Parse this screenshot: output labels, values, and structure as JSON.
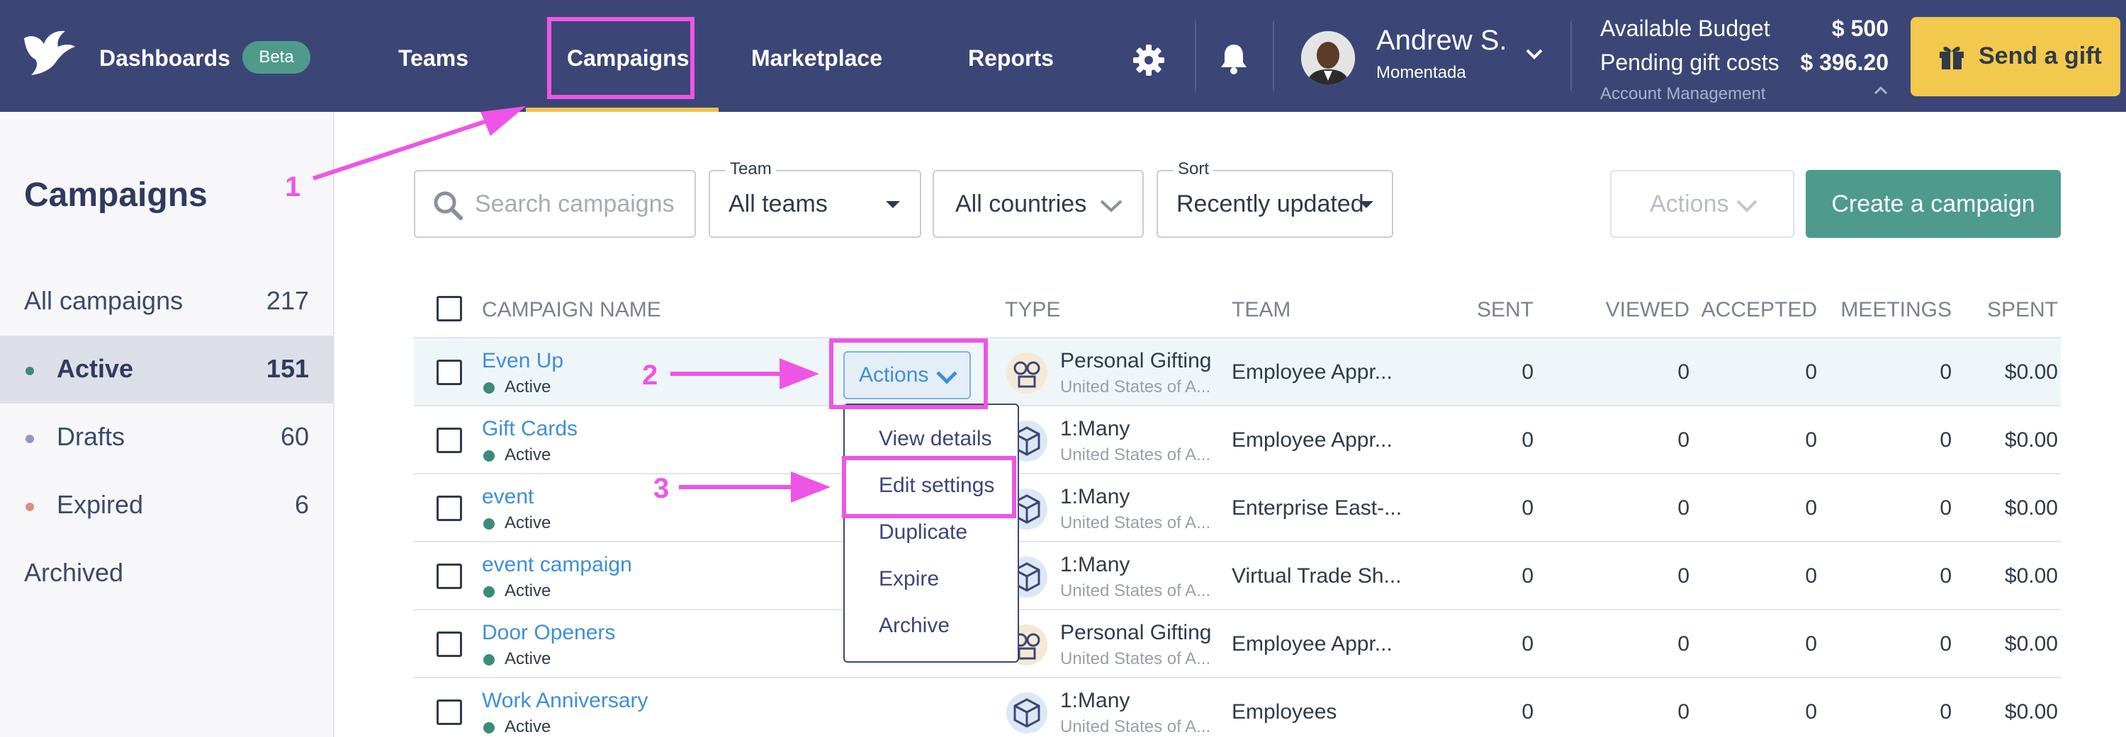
{
  "nav": {
    "dashboards": "Dashboards",
    "beta": "Beta",
    "teams": "Teams",
    "campaigns": "Campaigns",
    "marketplace": "Marketplace",
    "reports": "Reports"
  },
  "user": {
    "name": "Andrew S.",
    "org": "Momentada"
  },
  "budget": {
    "available_label": "Available Budget",
    "available_value": "$ 500",
    "pending_label": "Pending gift costs",
    "pending_value": "$ 396.20",
    "account_management": "Account Management"
  },
  "send_gift": "Send a gift",
  "sidebar": {
    "title": "Campaigns",
    "items": [
      {
        "label": "All campaigns",
        "count": "217"
      },
      {
        "label": "Active",
        "count": "151",
        "dot": "#3a8c7a"
      },
      {
        "label": "Drafts",
        "count": "60",
        "dot": "#8f97c4"
      },
      {
        "label": "Expired",
        "count": "6",
        "dot": "#e08a8a"
      },
      {
        "label": "Archived",
        "count": ""
      }
    ]
  },
  "filters": {
    "search_placeholder": "Search campaigns",
    "team_label": "Team",
    "team_value": "All teams",
    "country_value": "All countries",
    "sort_label": "Sort",
    "sort_value": "Recently updated",
    "actions": "Actions",
    "create": "Create a campaign"
  },
  "table": {
    "headers": {
      "name": "CAMPAIGN NAME",
      "type": "TYPE",
      "team": "TEAM",
      "sent": "SENT",
      "viewed": "VIEWED",
      "accepted": "ACCEPTED",
      "meetings": "MEETINGS",
      "spent": "SPENT"
    },
    "rows": [
      {
        "name": "Even Up",
        "status": "Active",
        "type": "Personal Gifting",
        "country": "United States of A...",
        "team": "Employee Appr...",
        "sent": "0",
        "viewed": "0",
        "accepted": "0",
        "meetings": "0",
        "spent": "$0.00"
      },
      {
        "name": "Gift Cards",
        "status": "Active",
        "type": "1:Many",
        "country": "United States of A...",
        "team": "Employee Appr...",
        "sent": "0",
        "viewed": "0",
        "accepted": "0",
        "meetings": "0",
        "spent": "$0.00"
      },
      {
        "name": "event",
        "status": "Active",
        "type": "1:Many",
        "country": "United States of A...",
        "team": "Enterprise East-...",
        "sent": "0",
        "viewed": "0",
        "accepted": "0",
        "meetings": "0",
        "spent": "$0.00"
      },
      {
        "name": "event campaign",
        "status": "Active",
        "type": "1:Many",
        "country": "United States of A...",
        "team": "Virtual Trade Sh...",
        "sent": "0",
        "viewed": "0",
        "accepted": "0",
        "meetings": "0",
        "spent": "$0.00"
      },
      {
        "name": "Door Openers",
        "status": "Active",
        "type": "Personal Gifting",
        "country": "United States of A...",
        "team": "Employee Appr...",
        "sent": "0",
        "viewed": "0",
        "accepted": "0",
        "meetings": "0",
        "spent": "$0.00"
      },
      {
        "name": "Work Anniversary",
        "status": "Active",
        "type": "1:Many",
        "country": "United States of A...",
        "team": "Employees",
        "sent": "0",
        "viewed": "0",
        "accepted": "0",
        "meetings": "0",
        "spent": "$0.00"
      }
    ]
  },
  "row_actions": {
    "button": "Actions",
    "menu": [
      "View details",
      "Edit settings",
      "Duplicate",
      "Expire",
      "Archive"
    ]
  },
  "annotations": {
    "one": "1",
    "two": "2",
    "three": "3",
    "color": "#ee55e6"
  }
}
